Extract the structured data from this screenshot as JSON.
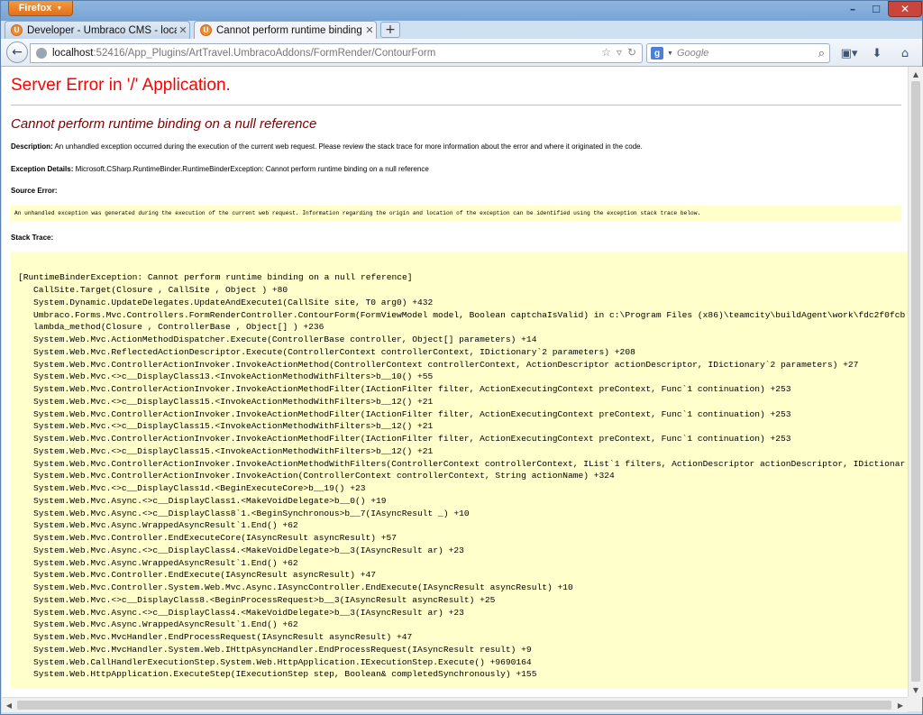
{
  "browser": {
    "app_button": "Firefox",
    "tabs": [
      {
        "label": "Developer - Umbraco CMS - localhost"
      },
      {
        "label": "Cannot perform runtime binding on ..."
      }
    ],
    "url_host": "localhost",
    "url_path": ":52416/App_Plugins/ArtTravel.UmbracoAddons/FormRender/ContourForm",
    "search_placeholder": "Google"
  },
  "page": {
    "title": "Server Error in '/' Application.",
    "subtitle": "Cannot perform runtime binding on a null reference",
    "description_label": "Description:",
    "description_text": " An unhandled exception occurred during the execution of the current web request. Please review the stack trace for more information about the error and where it originated in the code.",
    "exception_label": "Exception Details:",
    "exception_text": " Microsoft.CSharp.RuntimeBinder.RuntimeBinderException: Cannot perform runtime binding on a null reference",
    "source_error_label": "Source Error:",
    "source_error_text": "An unhandled exception was generated during the execution of the current web request. Information regarding the origin and location of the exception can be identified using the exception stack trace below.",
    "stack_trace_label": "Stack Trace:",
    "stack_header": "[RuntimeBinderException: Cannot perform runtime binding on a null reference]",
    "stack_lines": [
      "CallSite.Target(Closure , CallSite , Object ) +80",
      "System.Dynamic.UpdateDelegates.UpdateAndExecute1(CallSite site, T0 arg0) +432",
      "Umbraco.Forms.Mvc.Controllers.FormRenderController.ContourForm(FormViewModel model, Boolean captchaIsValid) in c:\\Program Files (x86)\\teamcity\\buildAgent\\work\\fdc2f0fcb",
      "lambda_method(Closure , ControllerBase , Object[] ) +236",
      "System.Web.Mvc.ActionMethodDispatcher.Execute(ControllerBase controller, Object[] parameters) +14",
      "System.Web.Mvc.ReflectedActionDescriptor.Execute(ControllerContext controllerContext, IDictionary`2 parameters) +208",
      "System.Web.Mvc.ControllerActionInvoker.InvokeActionMethod(ControllerContext controllerContext, ActionDescriptor actionDescriptor, IDictionary`2 parameters) +27",
      "System.Web.Mvc.<>c__DisplayClass13.<InvokeActionMethodWithFilters>b__10() +55",
      "System.Web.Mvc.ControllerActionInvoker.InvokeActionMethodFilter(IActionFilter filter, ActionExecutingContext preContext, Func`1 continuation) +253",
      "System.Web.Mvc.<>c__DisplayClass15.<InvokeActionMethodWithFilters>b__12() +21",
      "System.Web.Mvc.ControllerActionInvoker.InvokeActionMethodFilter(IActionFilter filter, ActionExecutingContext preContext, Func`1 continuation) +253",
      "System.Web.Mvc.<>c__DisplayClass15.<InvokeActionMethodWithFilters>b__12() +21",
      "System.Web.Mvc.ControllerActionInvoker.InvokeActionMethodFilter(IActionFilter filter, ActionExecutingContext preContext, Func`1 continuation) +253",
      "System.Web.Mvc.<>c__DisplayClass15.<InvokeActionMethodWithFilters>b__12() +21",
      "System.Web.Mvc.ControllerActionInvoker.InvokeActionMethodWithFilters(ControllerContext controllerContext, IList`1 filters, ActionDescriptor actionDescriptor, IDictionar",
      "System.Web.Mvc.ControllerActionInvoker.InvokeAction(ControllerContext controllerContext, String actionName) +324",
      "System.Web.Mvc.<>c__DisplayClass1d.<BeginExecuteCore>b__19() +23",
      "System.Web.Mvc.Async.<>c__DisplayClass1.<MakeVoidDelegate>b__0() +19",
      "System.Web.Mvc.Async.<>c__DisplayClass8`1.<BeginSynchronous>b__7(IAsyncResult _) +10",
      "System.Web.Mvc.Async.WrappedAsyncResult`1.End() +62",
      "System.Web.Mvc.Controller.EndExecuteCore(IAsyncResult asyncResult) +57",
      "System.Web.Mvc.Async.<>c__DisplayClass4.<MakeVoidDelegate>b__3(IAsyncResult ar) +23",
      "System.Web.Mvc.Async.WrappedAsyncResult`1.End() +62",
      "System.Web.Mvc.Controller.EndExecute(IAsyncResult asyncResult) +47",
      "System.Web.Mvc.Controller.System.Web.Mvc.Async.IAsyncController.EndExecute(IAsyncResult asyncResult) +10",
      "System.Web.Mvc.<>c__DisplayClass8.<BeginProcessRequest>b__3(IAsyncResult asyncResult) +25",
      "System.Web.Mvc.Async.<>c__DisplayClass4.<MakeVoidDelegate>b__3(IAsyncResult ar) +23",
      "System.Web.Mvc.Async.WrappedAsyncResult`1.End() +62",
      "System.Web.Mvc.MvcHandler.EndProcessRequest(IAsyncResult asyncResult) +47",
      "System.Web.Mvc.MvcHandler.System.Web.IHttpAsyncHandler.EndProcessRequest(IAsyncResult result) +9",
      "System.Web.CallHandlerExecutionStep.System.Web.HttpApplication.IExecutionStep.Execute() +9690164",
      "System.Web.HttpApplication.ExecuteStep(IExecutionStep step, Boolean& completedSynchronously) +155"
    ]
  }
}
